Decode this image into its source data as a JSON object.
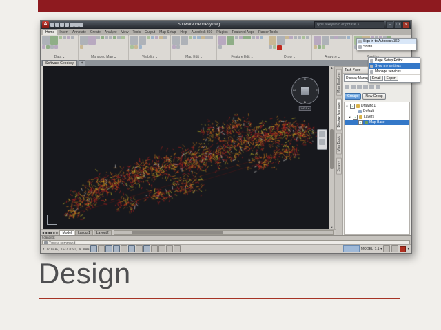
{
  "slide": {
    "title": "Design"
  },
  "titlebar": {
    "app_button": "A",
    "title": "Software Geodesy.dwg",
    "search_placeholder": "Type a keyword or phrase",
    "min": "–",
    "max": "❐",
    "close": "✕"
  },
  "ribbon": {
    "active_tab": "Home",
    "tabs": [
      "Home",
      "Insert",
      "Annotate",
      "Create",
      "Analyze",
      "View",
      "Tools",
      "Output",
      "Map Setup",
      "Help",
      "Autodesk 360",
      "Plugins",
      "Featured Apps",
      "Raster Tools"
    ],
    "panels": [
      {
        "caption": "Data"
      },
      {
        "caption": "Managed Map"
      },
      {
        "caption": "Visibility"
      },
      {
        "caption": "Map Edit"
      },
      {
        "caption": "Feature Edit"
      },
      {
        "caption": "Draw"
      },
      {
        "caption": "Analyze"
      },
      {
        "caption": "Palettes"
      }
    ]
  },
  "file_tabs": {
    "tab": "Software Geodesy",
    "new_tab": "+"
  },
  "canvas": {
    "map_colors": {
      "red": "#b82420",
      "orange": "#c97a1a",
      "yellow": "#d2c22c",
      "light": "#c8c8c8",
      "roads": "#7e1a16"
    },
    "viewcube": {
      "n": "N",
      "e": "E",
      "s": "S",
      "w": "W",
      "wcs": "WCS ▾"
    }
  },
  "task_pane": {
    "title": "Task Pane",
    "selector": "Display Manager",
    "tabs": [
      "Map Explorer",
      "Display Manager",
      "Map Book",
      "Survey"
    ],
    "active_tab_index": 1,
    "buttons": {
      "groups": "Groups",
      "new_group": "New Group"
    },
    "tree": [
      {
        "label": "Drawing1",
        "expanded": true,
        "checked": true,
        "indent": 0,
        "icon": "#d9b34a"
      },
      {
        "label": "Default",
        "indent": 12,
        "icon": "#8fa6c4"
      },
      {
        "label": "Layers",
        "expanded": true,
        "checked": true,
        "indent": 4,
        "icon": "#d9b34a"
      },
      {
        "label": "Map Base",
        "checked": true,
        "selected": true,
        "indent": 12,
        "icon": "#6d9c5e"
      }
    ]
  },
  "layout_tabs": {
    "model": "Model",
    "layout1": "Layout1",
    "layout2": "Layout2"
  },
  "command": {
    "history": "Command:",
    "placeholder": "Type a command"
  },
  "status": {
    "coords": "4172.8036, 1547.0291, 0.0000",
    "model_label": "MODEL",
    "scale": "1:1 ▾"
  },
  "popups": {
    "signin": {
      "row1": "Sign in to Autodesk 360",
      "row2": "Share"
    },
    "menu": {
      "items": [
        "Page Setup Editor",
        "Sync my settings",
        "Manage services"
      ],
      "highlight_index": 1,
      "buttons": [
        "Email",
        "Export"
      ]
    }
  }
}
